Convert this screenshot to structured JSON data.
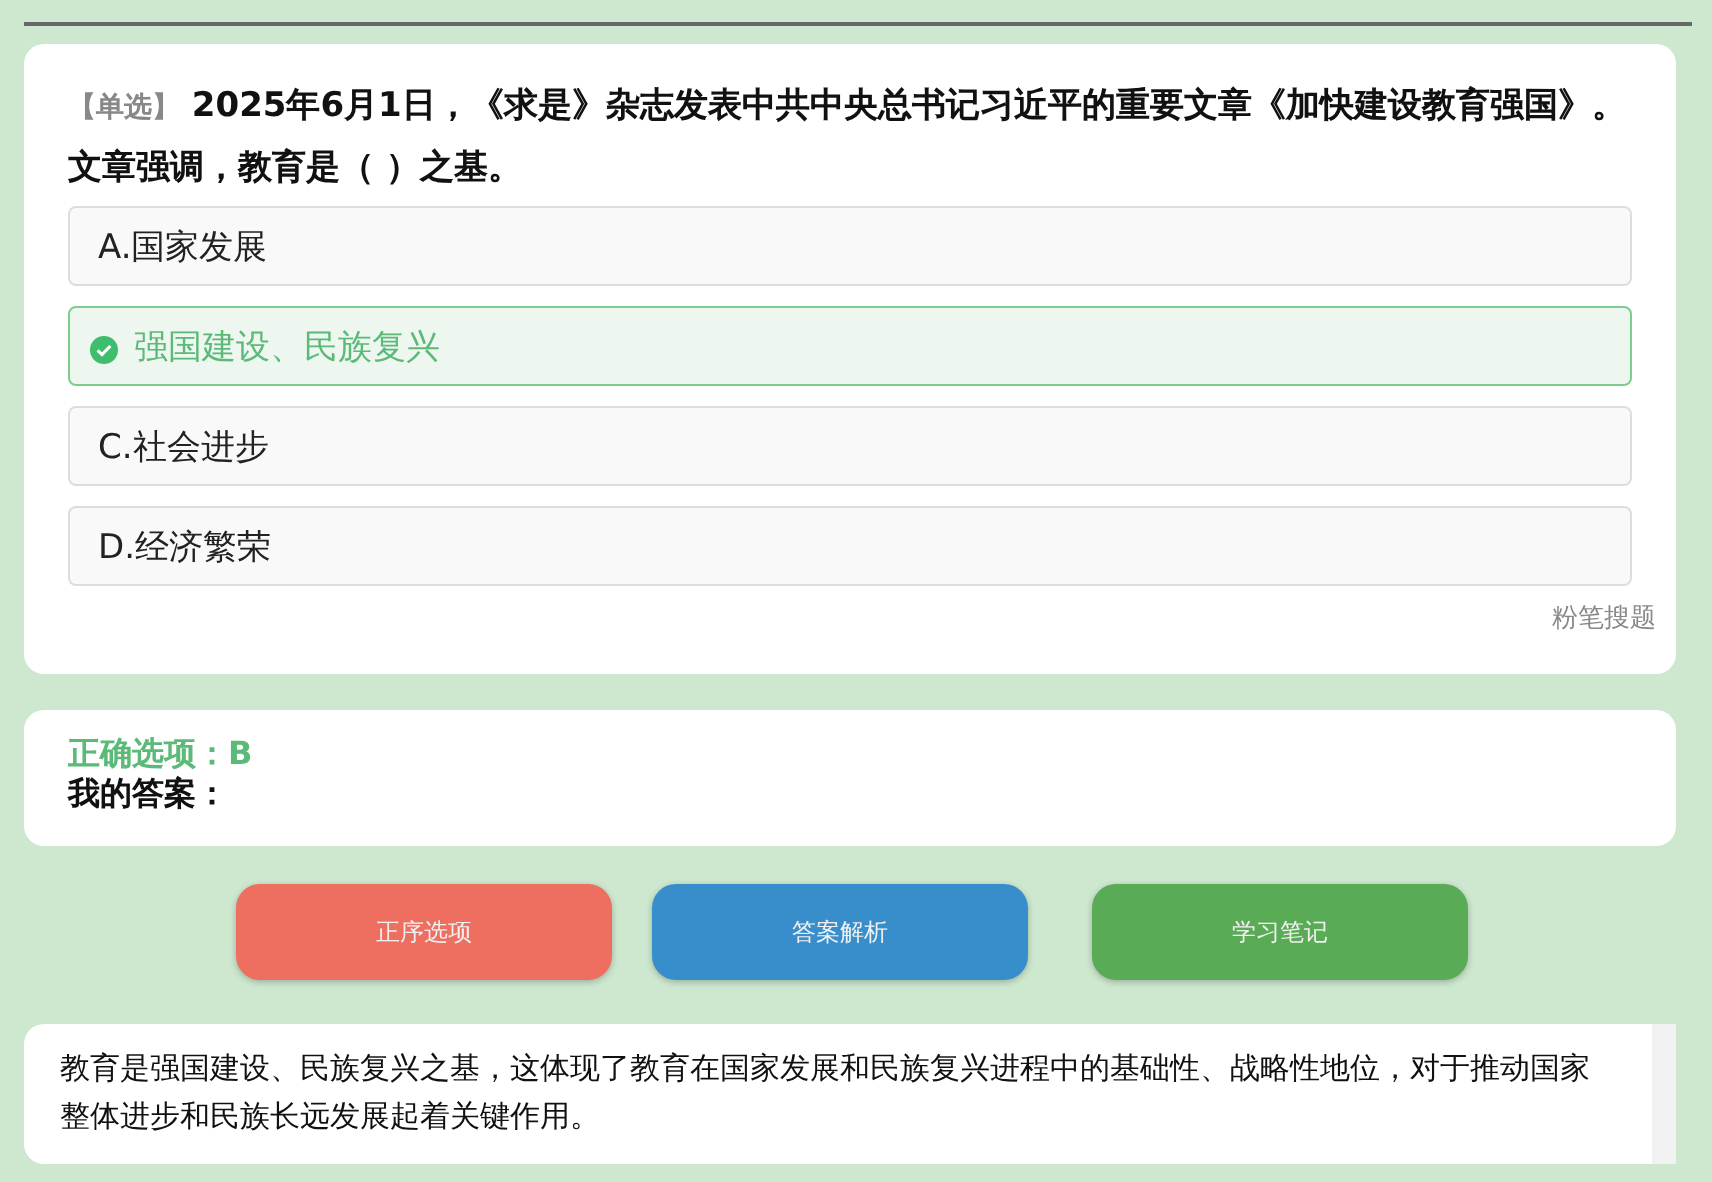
{
  "question": {
    "type_tag": "【单选】",
    "text": "2025年6月1日，《求是》杂志发表中共中央总书记习近平的重要文章《加快建设教育强国》。文章强调，教育是（ ）之基。",
    "options": [
      {
        "label": "A.国家发展",
        "selected": false
      },
      {
        "label": "强国建设、民族复兴",
        "selected": true
      },
      {
        "label": "C.社会进步",
        "selected": false
      },
      {
        "label": "D.经济繁荣",
        "selected": false
      }
    ],
    "source": "粉笔搜题"
  },
  "answer": {
    "correct": "正确选项：B",
    "mine": "我的答案："
  },
  "buttons": [
    {
      "label": "正序选项",
      "color": "#ee6e60"
    },
    {
      "label": "答案解析",
      "color": "#388ecb"
    },
    {
      "label": "学习笔记",
      "color": "#5aab55"
    }
  ],
  "explanation": "教育是强国建设、民族复兴之基，这体现了教育在国家发展和民族复兴进程中的基础性、战略性地位，对于推动国家整体进步和民族长远发展起着关键作用。"
}
